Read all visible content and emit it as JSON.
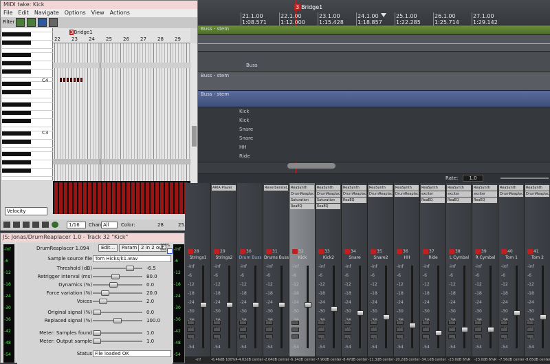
{
  "timeline": {
    "marker_top_label": "Bridge1",
    "marker_top_num": "3",
    "ticks": [
      {
        "label": "21.1.00",
        "time": "1:08.571"
      },
      {
        "label": "22.1.00",
        "time": "1:12.000"
      },
      {
        "label": "23.1.00",
        "time": "1:15.428"
      },
      {
        "label": "24.1.00",
        "time": "1:18.857"
      },
      {
        "label": "25.1.00",
        "time": "1:22.285"
      },
      {
        "label": "26.1.00",
        "time": "1:25.714"
      },
      {
        "label": "27.1.00",
        "time": "1:29.142"
      }
    ],
    "track_labels": [
      "Buss - stem",
      "Buss",
      "Buss - stem",
      "Buss - stem"
    ],
    "lane_labels": [
      "Kick",
      "Kick",
      "Snare",
      "Snare",
      "HH",
      "Ride"
    ],
    "rate_label": "Rate:",
    "rate_value": "1.0"
  },
  "midi": {
    "title": "MIDI take: Kick",
    "menu": [
      "File",
      "Edit",
      "Navigate",
      "Options",
      "View",
      "Actions"
    ],
    "filter_label": "Filter",
    "marker": {
      "num": "3",
      "label": "Bridge1"
    },
    "bars": [
      "22",
      "23",
      "24",
      "25",
      "26",
      "27",
      "28",
      "29"
    ],
    "key_labels": [
      "C4",
      "C3"
    ],
    "velocity_select": "Velocity",
    "grid_value": "1/16",
    "chan_label": "Chan:",
    "chan_value": "All",
    "color_label": "Color:",
    "pos_note": "28",
    "pos_time": "25.2.77"
  },
  "jsfx": {
    "title": "JS: Jonas/DrumReaplacer 1.0 - Track 32 \"Kick\"",
    "plugin_name": "DrumReaplacer 1.094",
    "edit_btn": "Edit...",
    "param_btn": "Param",
    "io_btn": "2 in 2 out",
    "wet_label": "100% wet",
    "sample_label": "Sample source file",
    "sample_value": "Tom Hicks/k1.wav",
    "params": [
      {
        "label": "Threshold (dB)",
        "value": "-6.5",
        "fraction": 0.8
      },
      {
        "label": "Retrigger interval (ms)",
        "value": "80.0",
        "fraction": 0.45
      },
      {
        "label": "Dynamics (%)",
        "value": "0.0",
        "fraction": 0.4
      },
      {
        "label": "Force variation (%)",
        "value": "20.0",
        "fraction": 0.2
      },
      {
        "label": "Voices",
        "value": "2.0",
        "fraction": 0.15
      },
      {
        "label": "Original signal (%)",
        "value": "0.0",
        "fraction": 0.0
      },
      {
        "label": "Replaced signal (%)",
        "value": "100.0",
        "fraction": 0.5
      },
      {
        "label": "Meter: Samples found",
        "value": "1.0",
        "fraction": 0.0
      },
      {
        "label": "Meter: Output sample",
        "value": "1.0",
        "fraction": 0.0
      }
    ],
    "status_label": "Status",
    "status_value": "File loaded OK",
    "meter_scale": [
      "-inf",
      "-6",
      "-12",
      "-18",
      "-24",
      "-30",
      "-36",
      "-42",
      "-48",
      "-54"
    ]
  },
  "mixer": {
    "strips": [
      {
        "num": "28",
        "name": "Strings1",
        "fx": [],
        "bottom": "-inf",
        "level": 0.55
      },
      {
        "num": "29",
        "name": "Strings2",
        "fx": [
          "ARIA Player"
        ],
        "bottom": "-6.46dB 100%R",
        "level": 0.55
      },
      {
        "num": "30",
        "name": "Drum Buss",
        "fx": [],
        "bottom": "-4.02dB center",
        "level": 0.55
      },
      {
        "num": "31",
        "name": "Drums Buss",
        "fx": [
          "ReverberateLE"
        ],
        "bottom": "-2.04dB center",
        "level": 0.55
      },
      {
        "num": "32",
        "name": "Kick",
        "fx": [
          "ReaSynth",
          "DrumReaplace",
          "Saturation",
          "ReaEQ"
        ],
        "bottom": "-6.14dB center",
        "level": 0.55
      },
      {
        "num": "33",
        "name": "Kick2",
        "fx": [
          "ReaSynth",
          "DrumReaplace",
          "Saturation",
          "ReaEQ"
        ],
        "bottom": "-7.90dB center",
        "level": 0.5
      },
      {
        "num": "34",
        "name": "Snare",
        "fx": [
          "ReaSynth",
          "DrumReaplace",
          "ReaEQ"
        ],
        "bottom": "-8.47dB center",
        "level": 0.45
      },
      {
        "num": "35",
        "name": "Snare2",
        "fx": [
          "ReaSynth",
          "DrumReaplace"
        ],
        "bottom": "-11.3dB center",
        "level": 0.4
      },
      {
        "num": "36",
        "name": "HH",
        "fx": [
          "ReaSynth",
          "DrumReaplace"
        ],
        "bottom": "-20.2dB center",
        "level": 0.3
      },
      {
        "num": "37",
        "name": "Ride",
        "fx": [
          "ReaSynth",
          "exciter",
          "ReaEQ"
        ],
        "bottom": "-34.1dB center",
        "level": 0.2
      },
      {
        "num": "38",
        "name": "L Cymbal",
        "fx": [
          "ReaSynth",
          "exciter",
          "ReaEQ"
        ],
        "bottom": "-23.0dB 6%R",
        "level": 0.25
      },
      {
        "num": "39",
        "name": "R Cymbal",
        "fx": [
          "ReaSynth",
          "exciter",
          "ReaEQ"
        ],
        "bottom": "-23.0dB 6%R",
        "level": 0.25
      },
      {
        "num": "40",
        "name": "Tom 1",
        "fx": [
          "ReaSynth",
          "DrumReaplace"
        ],
        "bottom": "-7.56dB center",
        "level": 0.45
      },
      {
        "num": "41",
        "name": "Tom 2",
        "fx": [
          "ReaSynth",
          "DrumReaplace"
        ],
        "bottom": "-8.65dB center",
        "level": 0.4
      }
    ],
    "scale": [
      "-inf",
      "-6",
      "-12",
      "-18",
      "-24",
      "-30",
      "-36",
      "-42",
      "-48",
      "-54"
    ]
  }
}
